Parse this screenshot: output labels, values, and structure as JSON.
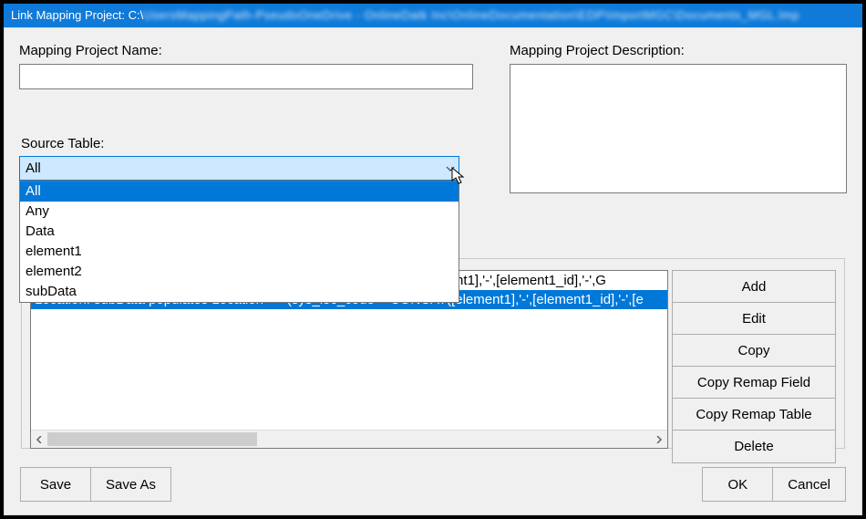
{
  "title": {
    "prefix": "Link Mapping Project: C:\\",
    "blurred": "UsersMappingPath-PseudoOneDrive - OnlineDatk Inc\\OnlineDocumentation\\EDP\\ImportMGC\\Documents_MGL.lmp"
  },
  "labels": {
    "name": "Mapping Project Name:",
    "description": "Mapping Project Description:",
    "source_table": "Source Table:"
  },
  "fields": {
    "name_value": "",
    "description_value": ""
  },
  "source_table": {
    "selected": "All",
    "options": [
      "All",
      "Any",
      "Data",
      "element1",
      "element2",
      "subData"
    ]
  },
  "list": {
    "rows": [
      "Location: All populates Location => (sys_loc_code = CONCAT([element1],'-',[element1_id],'-',G",
      "Location: subData populates Location => (sys_loc_code = CONCAT([element1],'-',[element1_id],'-',[e"
    ],
    "selected_index": 1
  },
  "side_buttons": [
    "Add",
    "Edit",
    "Copy",
    "Copy Remap Field",
    "Copy Remap Table",
    "Delete"
  ],
  "bottom": {
    "save": "Save",
    "save_as": "Save As",
    "ok": "OK",
    "cancel": "Cancel"
  }
}
